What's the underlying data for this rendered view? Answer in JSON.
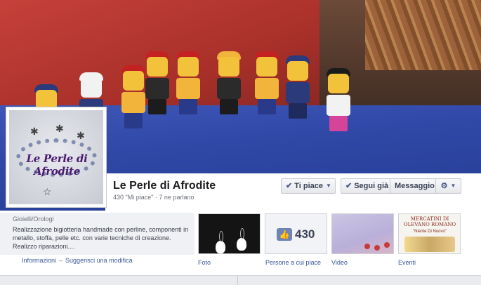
{
  "page": {
    "name": "Le Perle di Afrodite",
    "stats": "430 \"Mi piace\" · 7 ne parlano"
  },
  "profile_picture": {
    "logo_text": "Le Perle di Afrodite"
  },
  "actions": {
    "like_label": "Ti piace",
    "follow_label": "Segui già",
    "message_label": "Messaggio",
    "gear_icon": "gear-icon"
  },
  "about": {
    "category": "Gioielli/Orologi",
    "description": "Realizzazione bigiotteria handmade con perline, componenti in metallo, stoffa, pelle etc. con varie tecniche di creazione. Realizzo riparazioni....",
    "link_info": "Informazioni",
    "link_suggest": "Suggerisci una modifica",
    "separator": "–"
  },
  "tabs": [
    {
      "label": "Foto"
    },
    {
      "label": "Persone a cui piace",
      "count": "430"
    },
    {
      "label": "Video"
    },
    {
      "label": "Eventi"
    }
  ],
  "events_thumb": {
    "title": "MERCATINI DI OLEVANO ROMANO",
    "subtitle": "\"Niente Di Nuovo\""
  },
  "colors": {
    "link": "#3b5998",
    "brand_blue": "#6d84b4",
    "logo_purple": "#4a1a70"
  }
}
